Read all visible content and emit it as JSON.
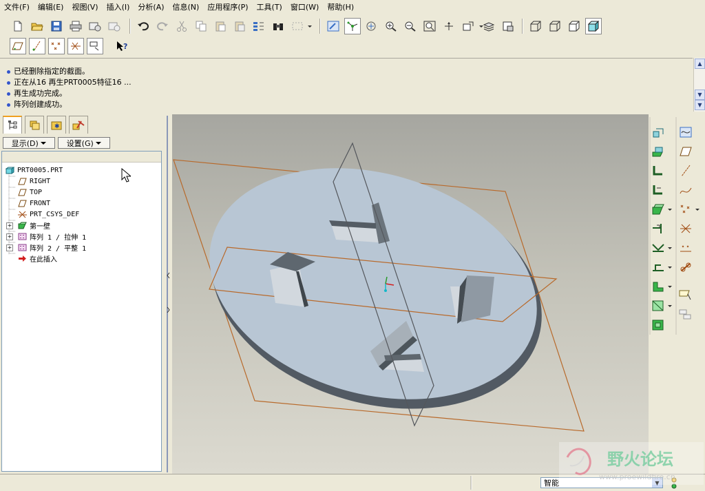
{
  "menu": [
    "文件(F)",
    "编辑(E)",
    "视图(V)",
    "插入(I)",
    "分析(A)",
    "信息(N)",
    "应用程序(P)",
    "工具(T)",
    "窗口(W)",
    "帮助(H)"
  ],
  "toolbar_top": [
    "new-file-icon",
    "open-folder-icon",
    "save-icon",
    "print-icon",
    "send-mail-icon",
    "mail-icon",
    "undo-icon",
    "redo-icon",
    "cut-icon",
    "copy-icon",
    "paste-icon",
    "paste-special-icon",
    "regenerate-icon",
    "find-icon",
    "select-box-icon",
    "repaint-icon",
    "spin-center-icon",
    "orient-icon",
    "zoom-in-icon",
    "zoom-out-icon",
    "refit-icon",
    "reorient-icon",
    "saved-views-icon",
    "layers-icon",
    "view-manager-icon",
    "wireframe-icon",
    "hidden-line-icon",
    "no-hidden-icon",
    "shading-icon"
  ],
  "toolbar_second": [
    "datum-planes-icon",
    "datum-axes-icon",
    "datum-points-icon",
    "coordinate-systems-icon",
    "whats-this-icon"
  ],
  "messages": [
    "已经删除指定的截面。",
    "正在从16 再生PRT0005特征16 ...",
    "再生成功完成。",
    "阵列创建成功。"
  ],
  "left_tabs": [
    "model-tree-icon",
    "folder-browser-icon",
    "favorites-icon",
    "connections-icon"
  ],
  "show_menu": "显示(D)",
  "settings_menu": "设置(G)",
  "tree": [
    {
      "label": "PRT0005.PRT",
      "icon": "part-icon",
      "expander": false
    },
    {
      "label": "RIGHT",
      "icon": "datum-plane-icon",
      "expander": false
    },
    {
      "label": "TOP",
      "icon": "datum-plane-icon",
      "expander": false
    },
    {
      "label": "FRONT",
      "icon": "datum-plane-icon",
      "expander": false
    },
    {
      "label": "PRT_CSYS_DEF",
      "icon": "csys-icon",
      "expander": false
    },
    {
      "label": "第一壁",
      "icon": "first-wall-icon",
      "expander": true
    },
    {
      "label": "阵列 1 / 拉伸 1",
      "icon": "pattern-icon",
      "expander": true
    },
    {
      "label": "阵列 2 / 平整 1",
      "icon": "pattern-icon",
      "expander": true
    },
    {
      "label": "在此插入",
      "icon": "insert-here-icon",
      "expander": false
    }
  ],
  "right_toolbar": [
    "convert-icon",
    "wall-icon",
    "flange-icon",
    "extend-icon",
    "flat-icon",
    "unbend-icon",
    "bend-back-icon",
    "form-icon",
    "corner-relief-icon",
    "rip-icon",
    "merge-icon",
    "flat-pattern-icon",
    "sketch-icon",
    "plane-icon",
    "axis-icon",
    "curve-icon",
    "point-icon",
    "csys-icon",
    "analysis-icon",
    "publish-icon",
    "select-icon",
    "query-icon"
  ],
  "status": {
    "filter_value": "智能"
  },
  "watermark": {
    "title": "野火论坛",
    "url": "www.proewildfire.cn"
  },
  "colors": {
    "part_face": "#b8c6d4",
    "datum_plane": "#b8692a",
    "background_top": "#a6a6a0",
    "background_bottom": "#dcdad0"
  }
}
